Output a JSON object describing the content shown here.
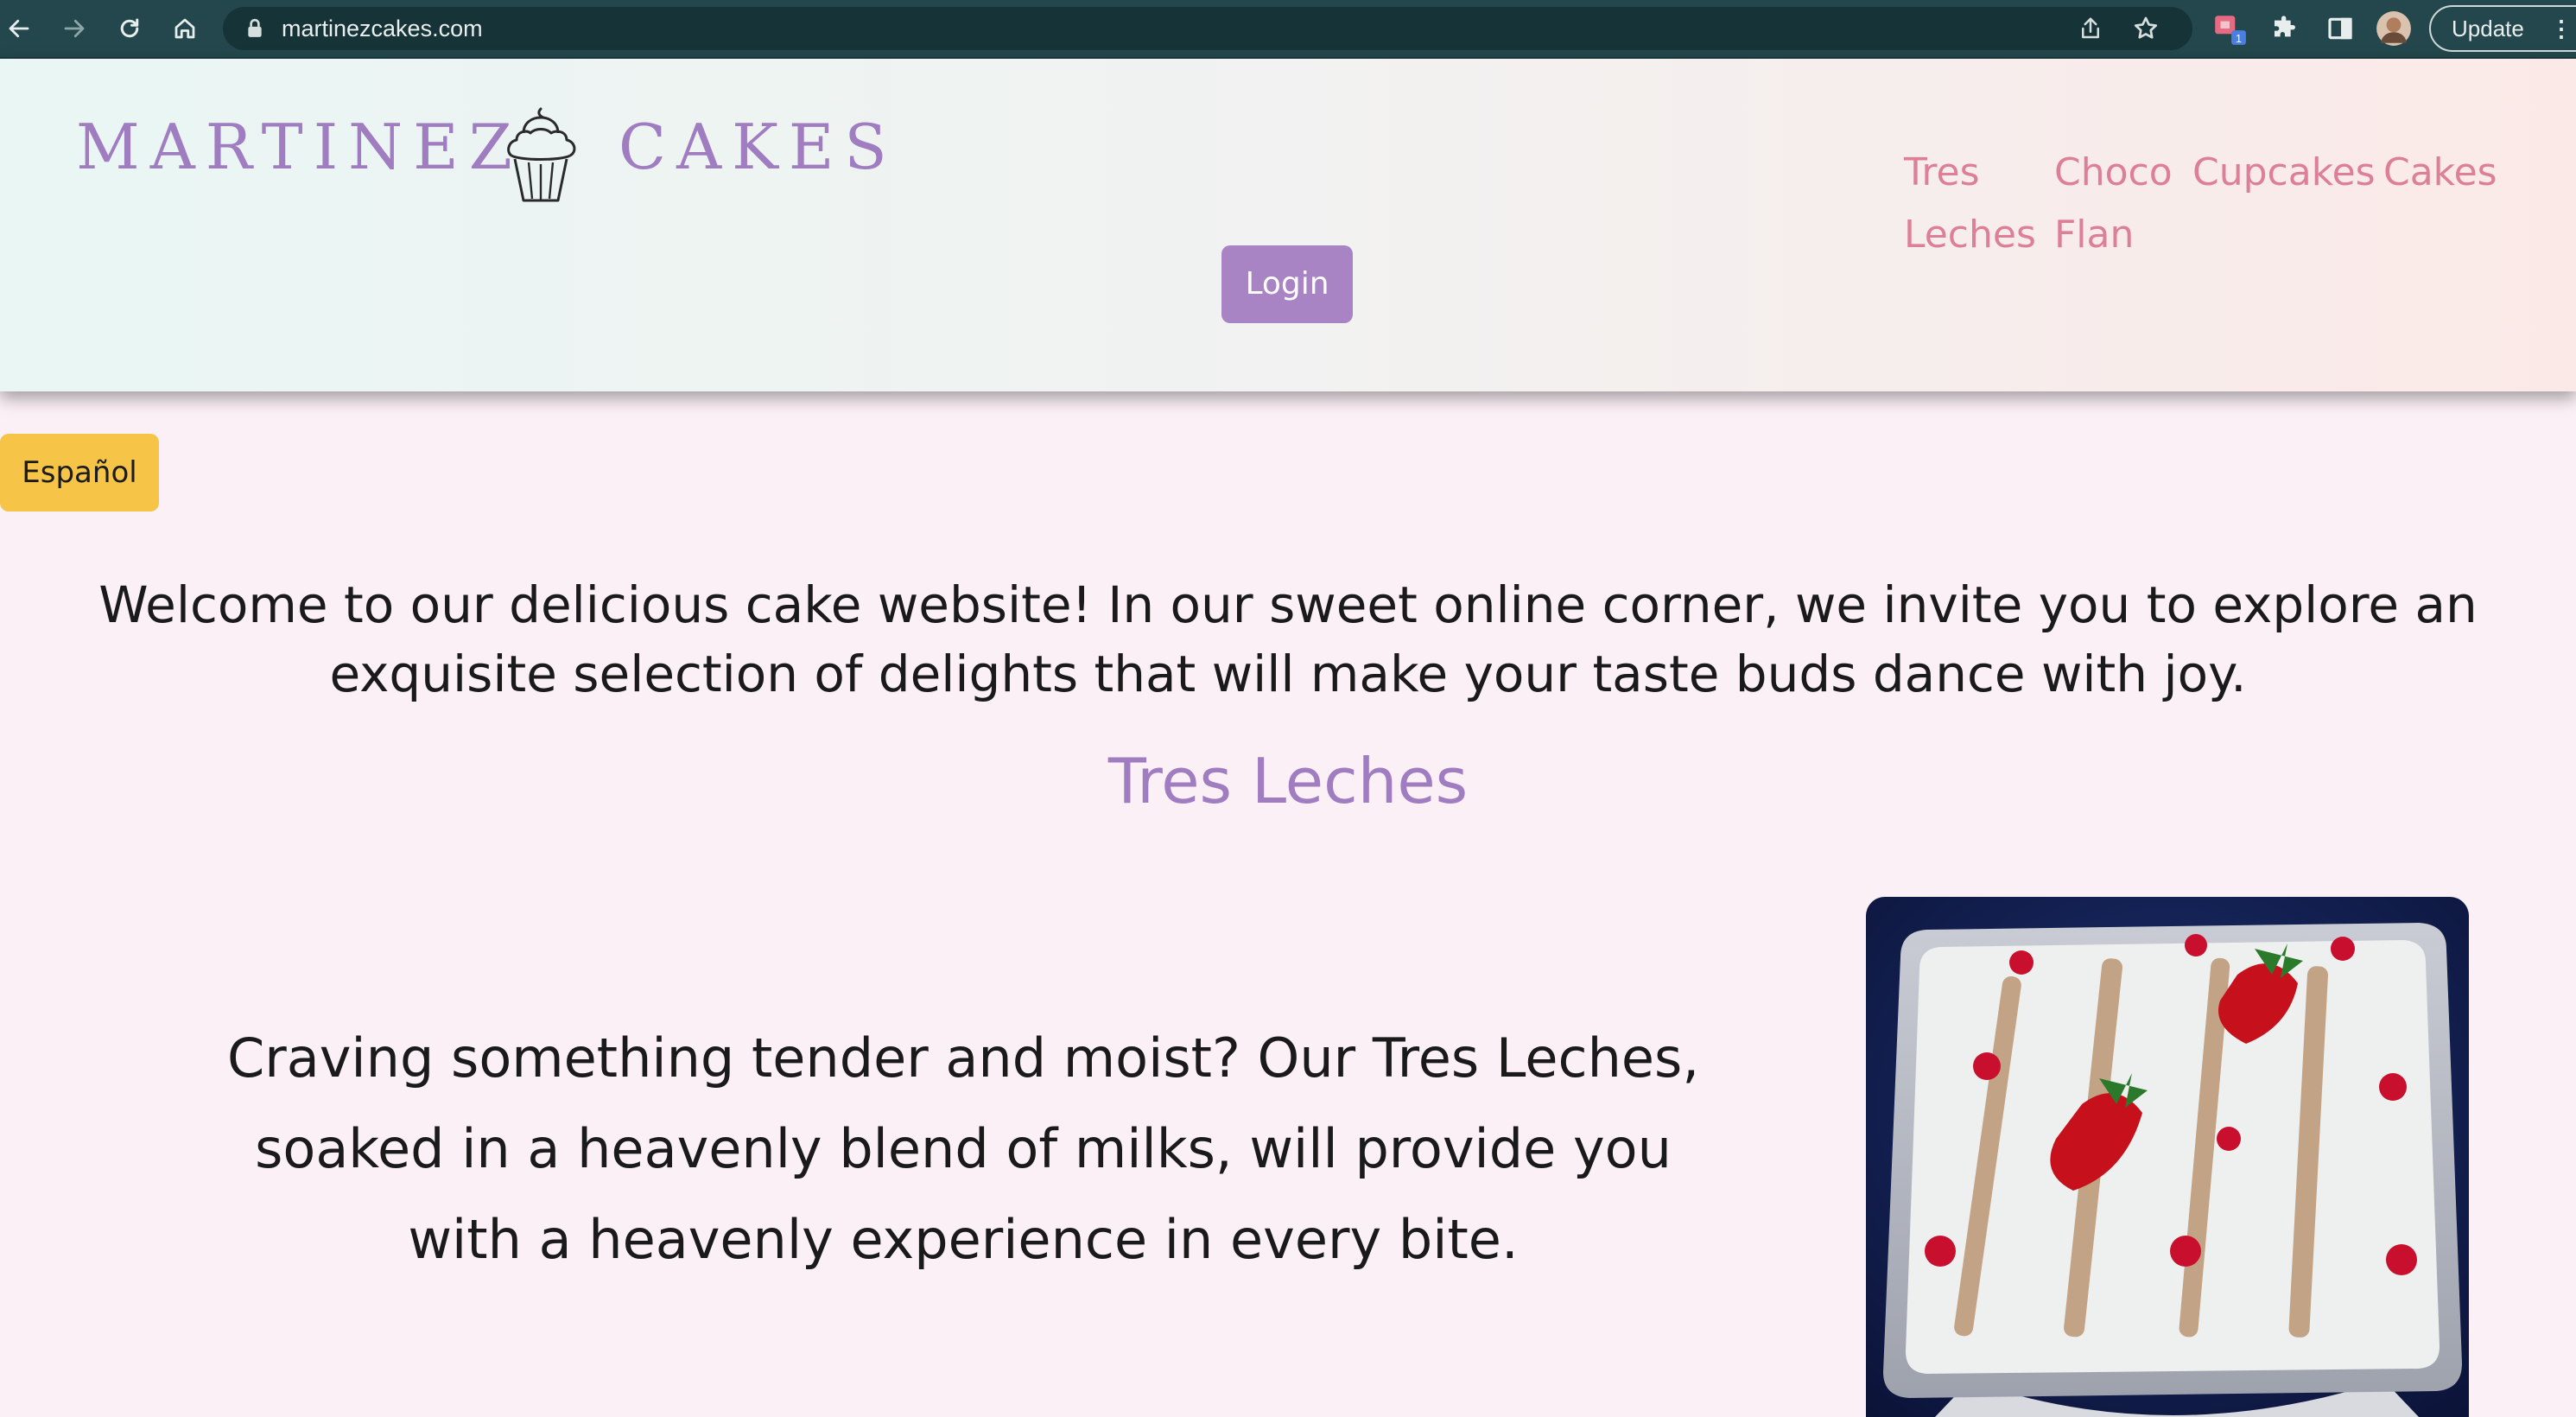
{
  "browser": {
    "url": "martinezcakes.com",
    "update_label": "Update",
    "extension_badge": "1"
  },
  "site": {
    "logo_left": "MARTINEZ",
    "logo_right": "CAKES",
    "nav": [
      {
        "line1": "Tres",
        "line2": "Leches"
      },
      {
        "line1": "Choco",
        "line2": "Flan"
      },
      {
        "line1": "Cupcakes"
      },
      {
        "line1": "Cakes"
      }
    ],
    "login_label": "Login",
    "language_label": "Español"
  },
  "main": {
    "welcome": "Welcome to our delicious cake website! In our sweet online corner, we invite you to explore an exquisite selection of delights that will make your taste buds dance with joy.",
    "product_title": "Tres Leches",
    "product_description": "Craving something tender and moist? Our Tres Leches, soaked in a heavenly blend of milks, will provide you with a heavenly experience in every bite."
  },
  "colors": {
    "chrome_bg": "#23474c",
    "brand_purple": "#a07cc0",
    "nav_pink": "#dd7f96",
    "login_purple": "#a884c4",
    "espanol_yellow": "#f6c446",
    "page_bg": "#fbf0f6"
  },
  "icons": [
    "back-arrow-icon",
    "forward-arrow-icon",
    "reload-icon",
    "home-icon",
    "lock-icon",
    "share-icon",
    "star-icon",
    "extension-icon",
    "puzzle-icon",
    "sidepanel-icon",
    "avatar",
    "kebab-menu-icon",
    "cupcake-logo-icon"
  ]
}
